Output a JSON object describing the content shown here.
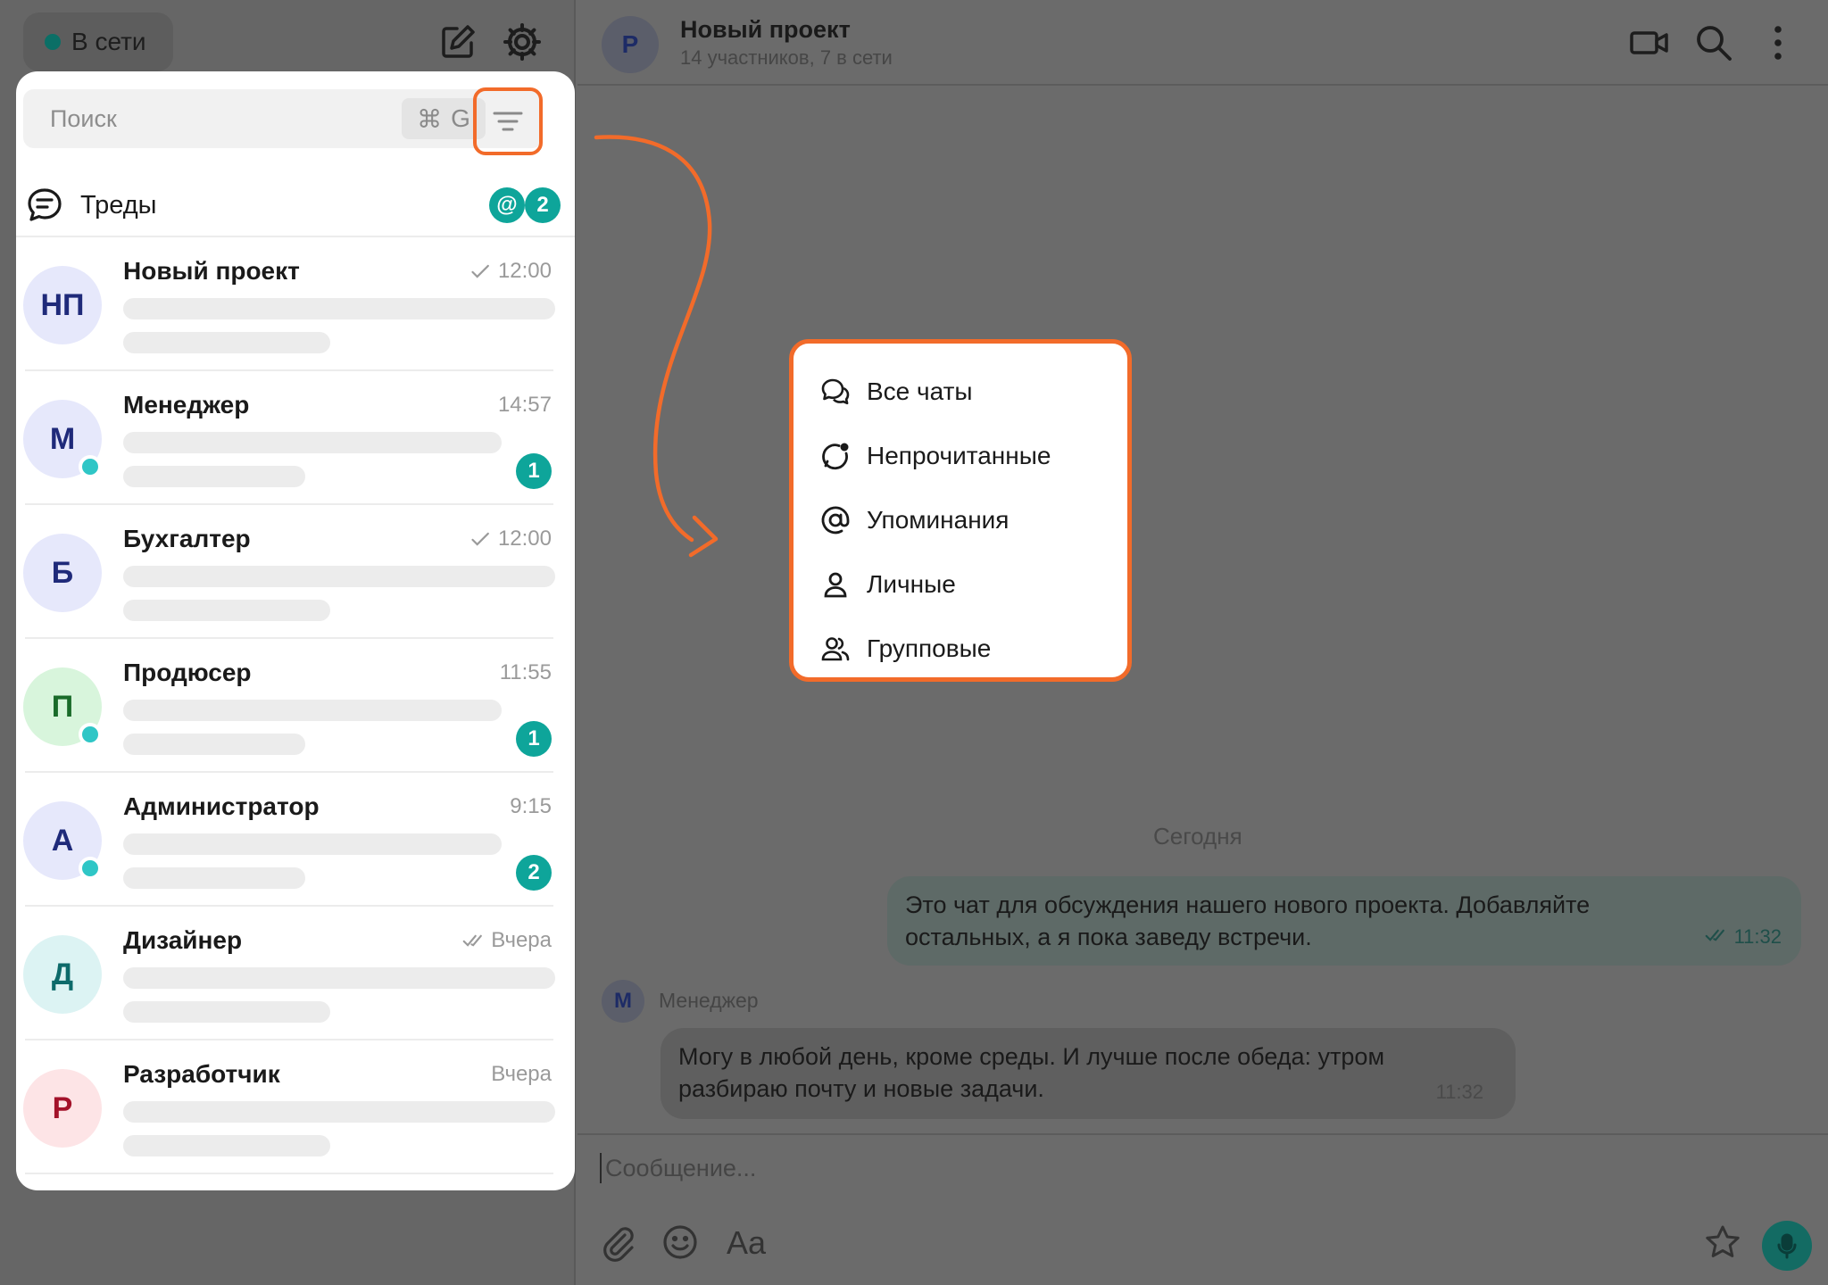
{
  "status": {
    "label": "В сети",
    "dot_color": "#0b6f66"
  },
  "header": {
    "avatar_letter": "Р",
    "title": "Новый проект",
    "subtitle": "14 участников, 7 в сети"
  },
  "search": {
    "placeholder": "Поиск",
    "shortcut_symbol": "⌘",
    "shortcut_key": "G"
  },
  "threads": {
    "label": "Треды",
    "mention_badge": "@",
    "count_badge": "2"
  },
  "chats": [
    {
      "initials": "НП",
      "name": "Новый проект",
      "time": "12:00",
      "check": "single",
      "online": false,
      "unread": "",
      "avatar_bg": "#e6e8fb",
      "avatar_fg": "#1f2a7a"
    },
    {
      "initials": "М",
      "name": "Менеджер",
      "time": "14:57",
      "check": "none",
      "online": true,
      "unread": "1",
      "avatar_bg": "#e6e8fb",
      "avatar_fg": "#1f2a7a"
    },
    {
      "initials": "Б",
      "name": "Бухгалтер",
      "time": "12:00",
      "check": "single",
      "online": false,
      "unread": "",
      "avatar_bg": "#e6e8fb",
      "avatar_fg": "#1f2a7a"
    },
    {
      "initials": "П",
      "name": "Продюсер",
      "time": "11:55",
      "check": "none",
      "online": true,
      "unread": "1",
      "avatar_bg": "#d8f5dc",
      "avatar_fg": "#1a6b2a"
    },
    {
      "initials": "А",
      "name": "Администратор",
      "time": "9:15",
      "check": "none",
      "online": true,
      "unread": "2",
      "avatar_bg": "#e6e8fb",
      "avatar_fg": "#1f2a7a"
    },
    {
      "initials": "Д",
      "name": "Дизайнер",
      "time": "Вчера",
      "check": "double",
      "online": false,
      "unread": "",
      "avatar_bg": "#dcf3f3",
      "avatar_fg": "#0d6a6a"
    },
    {
      "initials": "Р",
      "name": "Разработчик",
      "time": "Вчера",
      "check": "none",
      "online": false,
      "unread": "",
      "avatar_bg": "#fde4e6",
      "avatar_fg": "#a3122a"
    }
  ],
  "filter_menu": [
    {
      "icon": "chats-icon",
      "label": "Все чаты"
    },
    {
      "icon": "unread-icon",
      "label": "Непрочитанные"
    },
    {
      "icon": "at-icon",
      "label": "Упоминания"
    },
    {
      "icon": "person-icon",
      "label": "Личные"
    },
    {
      "icon": "group-icon",
      "label": "Групповые"
    }
  ],
  "messages": {
    "day": "Сегодня",
    "outgoing_line1": "Это чат для обсуждения нашего нового проекта. Добавляйте",
    "outgoing_line2": "остальных, а я пока заведу встречи.",
    "outgoing_time": "11:32",
    "sender_initial": "М",
    "sender_name": "Менеджер",
    "incoming_line1": "Могу в любой день, кроме среды. И лучше после обеда: утром",
    "incoming_line2": "разбираю почту и новые задачи.",
    "incoming_time": "11:32"
  },
  "composer": {
    "placeholder": "Сообщение...",
    "font_button": "Aa"
  },
  "colors": {
    "accent": "#f26b2a",
    "teal": "#0ea59a",
    "online": "#2fc6c6"
  }
}
